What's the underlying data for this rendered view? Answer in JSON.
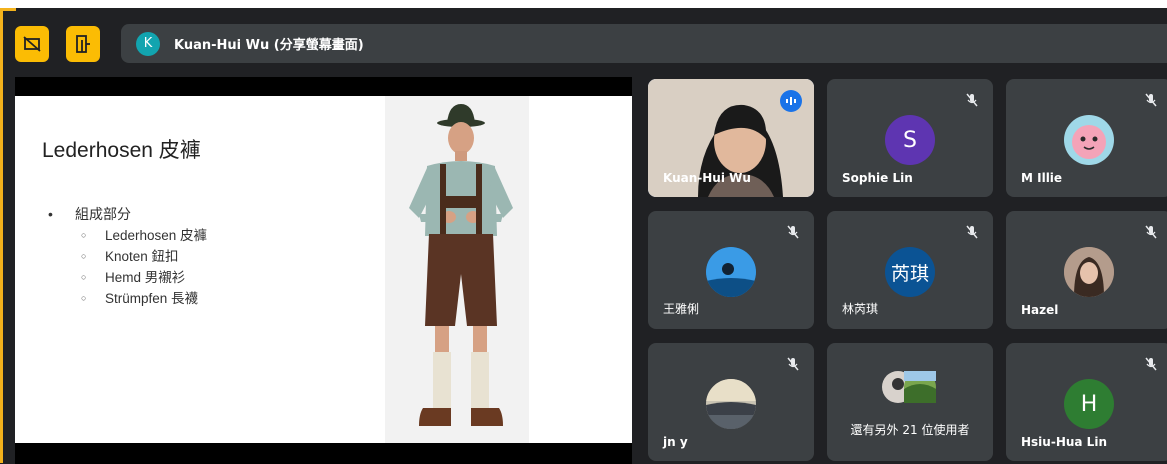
{
  "presentation_bar": {
    "presenter_initial": "K",
    "text": "Kuan-Hui Wu (分享螢幕畫面)"
  },
  "slide": {
    "title": "Lederhosen 皮褲",
    "bullet_main": "組成部分",
    "sub_items": [
      "Lederhosen 皮褲",
      "Knoten 鈕扣",
      "Hemd 男襯衫",
      "Strümpfen 長襪"
    ]
  },
  "participants": [
    {
      "name": "Kuan-Hui Wu"
    },
    {
      "name": "Sophie Lin",
      "initial": "S",
      "color": "#5e35b1"
    },
    {
      "name": "M Illie"
    },
    {
      "name": "王雅俐"
    },
    {
      "name": "林芮琪",
      "initial": "芮琪",
      "color": "#0b5394"
    },
    {
      "name": "Hazel"
    },
    {
      "name": "jn y"
    },
    {
      "name": "還有另外 21 位使用者"
    },
    {
      "name": "Hsiu-Hua Lin",
      "initial": "H",
      "color": "#2e7d32"
    }
  ]
}
